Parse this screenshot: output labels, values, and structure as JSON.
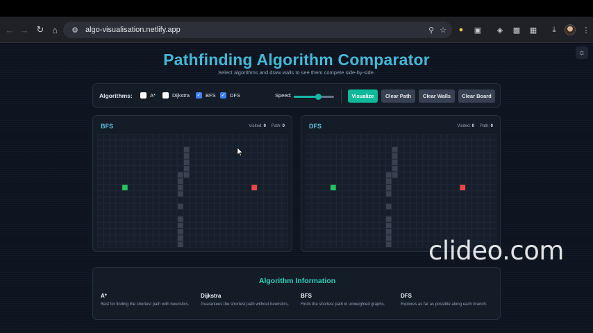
{
  "browser": {
    "url": "algo-visualisation.netlify.app",
    "back_icon": "arrow-left-icon",
    "forward_icon": "arrow-right-icon",
    "reload_icon": "reload-icon",
    "home_icon": "home-icon"
  },
  "page": {
    "title": "Pathfinding Algorithm Comparator",
    "subtitle": "Select algorithms and draw walls to see them compete side-by-side."
  },
  "controls": {
    "algorithms_label": "Algorithms:",
    "algorithms": [
      {
        "label": "A*",
        "checked": false
      },
      {
        "label": "Dijkstra",
        "checked": false
      },
      {
        "label": "BFS",
        "checked": true
      },
      {
        "label": "DFS",
        "checked": true
      }
    ],
    "speed_label": "Speed:",
    "speed_value": 0.6,
    "buttons": {
      "visualize": "Visualize",
      "clear_path": "Clear Path",
      "clear_walls": "Clear Walls",
      "clear_board": "Clear Board"
    }
  },
  "panels": [
    {
      "name": "BFS",
      "visited_label": "Visited:",
      "visited": "0",
      "path_label": "Path:",
      "path": "0"
    },
    {
      "name": "DFS",
      "visited_label": "Visited:",
      "visited": "0",
      "path_label": "Path:",
      "path": "0"
    }
  ],
  "grid": {
    "cols": 31,
    "rows": 18,
    "start": {
      "col": 4,
      "row": 8
    },
    "end": {
      "col": 25,
      "row": 8
    },
    "walls": [
      [
        14,
        2
      ],
      [
        14,
        3
      ],
      [
        14,
        4
      ],
      [
        14,
        5
      ],
      [
        14,
        6
      ],
      [
        13,
        6
      ],
      [
        13,
        7
      ],
      [
        13,
        8
      ],
      [
        13,
        9
      ],
      [
        13,
        11
      ],
      [
        13,
        13
      ],
      [
        13,
        14
      ],
      [
        13,
        15
      ],
      [
        13,
        16
      ],
      [
        13,
        17
      ]
    ],
    "colors": {
      "start": "#22c55e",
      "end": "#ef4444",
      "wall": "#3a4150",
      "cell": "#161e2b",
      "line": "#222b38"
    }
  },
  "info": {
    "title": "Algorithm Information",
    "items": [
      {
        "name": "A*",
        "desc": "Best for finding the shortest path with heuristics."
      },
      {
        "name": "Dijkstra",
        "desc": "Guarantees the shortest path without heuristics."
      },
      {
        "name": "BFS",
        "desc": "Finds the shortest path in unweighted graphs."
      },
      {
        "name": "DFS",
        "desc": "Explores as far as possible along each branch."
      }
    ]
  },
  "watermark": "clideo.com"
}
